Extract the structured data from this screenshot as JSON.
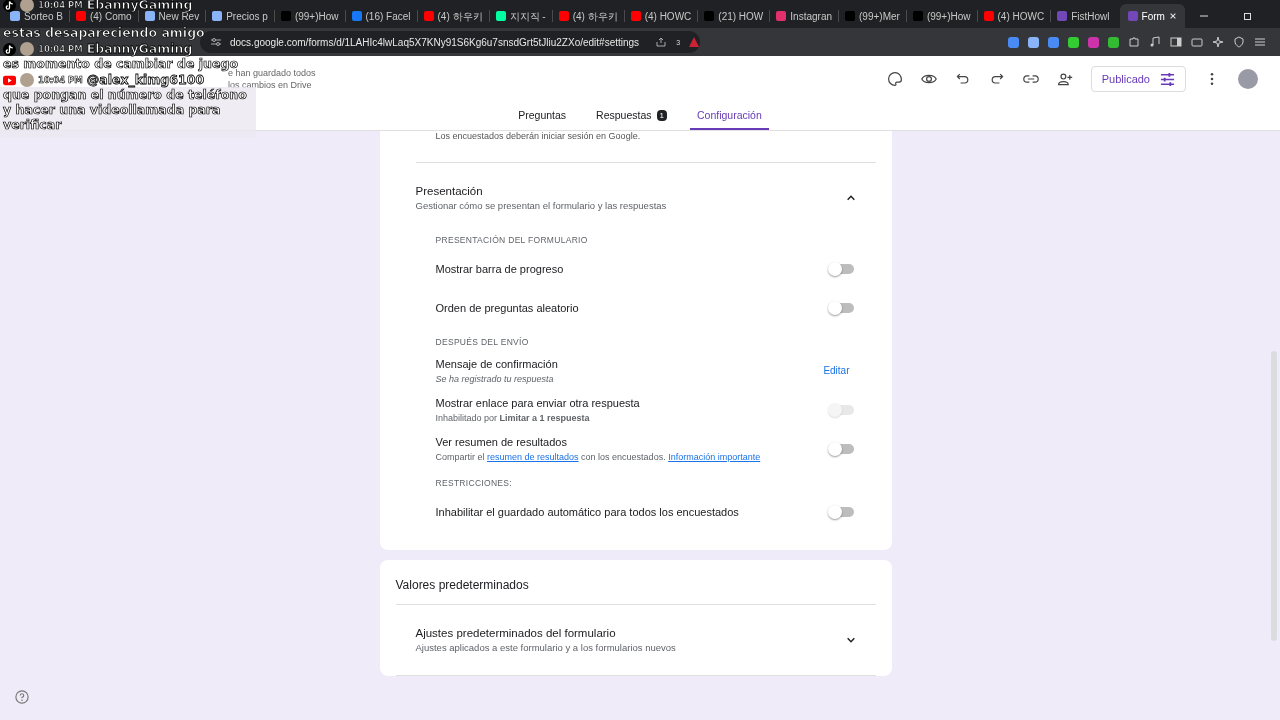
{
  "browser": {
    "tabs": [
      {
        "label": "Sorteo B",
        "kind": "globe",
        "selected": false
      },
      {
        "label": "(4) Como",
        "kind": "youtube",
        "selected": false
      },
      {
        "label": "New Rev",
        "kind": "globe",
        "selected": false
      },
      {
        "label": "Precios p",
        "kind": "globe",
        "selected": false
      },
      {
        "label": "(99+)How",
        "kind": "tiktok",
        "selected": false
      },
      {
        "label": "(16) Facel",
        "kind": "facebook",
        "selected": false
      },
      {
        "label": "(4) 하우키",
        "kind": "youtube",
        "selected": false
      },
      {
        "label": "지지직 -",
        "kind": "chzzk",
        "selected": false
      },
      {
        "label": "(4) 하우키",
        "kind": "youtube",
        "selected": false
      },
      {
        "label": "(4) HOWC",
        "kind": "youtube",
        "selected": false
      },
      {
        "label": "(21) HOW",
        "kind": "x",
        "selected": false
      },
      {
        "label": "Instagran",
        "kind": "instagram",
        "selected": false
      },
      {
        "label": "(99+)Mer",
        "kind": "tiktok",
        "selected": false
      },
      {
        "label": "(99+)How",
        "kind": "tiktok",
        "selected": false
      },
      {
        "label": "(4) HOWC",
        "kind": "youtube",
        "selected": false
      },
      {
        "label": "FistHowl",
        "kind": "forms",
        "selected": false
      },
      {
        "label": "Form",
        "kind": "forms",
        "selected": true
      }
    ],
    "url": "docs.google.com/forms/d/1LAHIc4lwLaq5X7KNy91S6Kg6u7snsdGrt5tJliu2ZXo/edit#settings",
    "shield_count": "3"
  },
  "chat_overlay": {
    "messages": [
      {
        "kind": "tiktok",
        "time": "10:04 PM",
        "user": "EbannyGaming",
        "text": "estas desapareciendo amigo"
      },
      {
        "kind": "tiktok",
        "time": "10:04 PM",
        "user": "EbannyGaming",
        "text": "es momento de cambiar de juego"
      },
      {
        "kind": "youtube",
        "time": "10:04 PM",
        "user": "@alex_kimg6100",
        "text": "que pongan el número de teléfono y hacer una videollamada para verificar"
      }
    ]
  },
  "forms_header": {
    "save_status": "e han guardado todos los cambios en Drive",
    "publish_button": "Publicado",
    "nav": [
      {
        "label": "Preguntas",
        "selected": false
      },
      {
        "label": "Respuestas",
        "badge": "1",
        "selected": false
      },
      {
        "label": "Configuración",
        "selected": true
      }
    ]
  },
  "settings": {
    "cut_text": "Los encuestados deberán iniciar sesión en Google.",
    "section": {
      "title": "Presentación",
      "subtitle": "Gestionar cómo se presentan el formulario y las respuestas",
      "expanded": true,
      "groups": [
        {
          "heading": "PRESENTACIÓN DEL FORMULARIO",
          "rows": [
            {
              "kind": "toggle",
              "label": "Mostrar barra de progreso",
              "on": false,
              "disabled": false
            },
            {
              "kind": "toggle",
              "label": "Orden de preguntas aleatorio",
              "on": false,
              "disabled": false
            }
          ]
        },
        {
          "heading": "DESPUÉS DEL ENVÍO",
          "rows": [
            {
              "kind": "action",
              "label": "Mensaje de confirmación",
              "note": "Se ha registrado tu respuesta",
              "action": "Editar"
            },
            {
              "kind": "toggle",
              "label": "Mostrar enlace para enviar otra respuesta",
              "note": "Inhabilitado por **Limitar a 1 respuesta**",
              "on": false,
              "disabled": true
            },
            {
              "kind": "toggle",
              "label": "Ver resumen de resultados",
              "parts": [
                {
                  "text": "Compartir el ",
                  "link": false
                },
                {
                  "text": "resumen de resultados",
                  "link": true
                },
                {
                  "text": " con los encuestados. ",
                  "link": false
                },
                {
                  "text": "Información importante",
                  "link": true
                }
              ],
              "on": false,
              "disabled": false
            }
          ]
        },
        {
          "heading": "RESTRICCIONES:",
          "rows": [
            {
              "kind": "toggle",
              "label": "Inhabilitar el guardado automático para todos los encuestados",
              "on": false,
              "disabled": false
            }
          ]
        }
      ]
    },
    "defaults": {
      "title": "Valores predeterminados",
      "item": {
        "title": "Ajustes predeterminados del formulario",
        "subtitle": "Ajustes aplicados a este formulario y a los formularios nuevos",
        "expanded": false
      }
    }
  }
}
